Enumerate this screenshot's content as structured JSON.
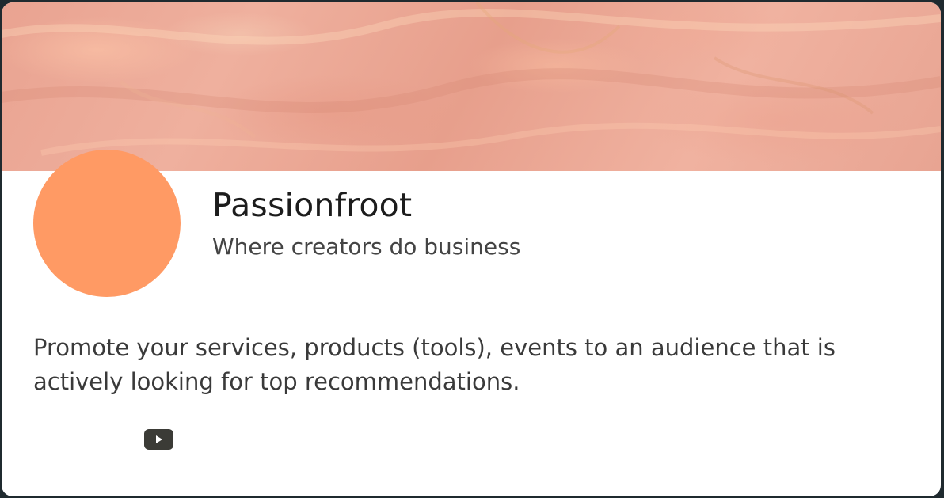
{
  "profile": {
    "name": "Passionfroot",
    "tagline": "Where creators do business",
    "description": "Promote your services, products (tools), events to an audience that is actively looking for top recommendations."
  },
  "colors": {
    "avatar": "#ff9a64",
    "banner": "#e9a391",
    "page_background": "#a9d8ea"
  },
  "social": {
    "youtube_icon": "youtube-icon"
  }
}
